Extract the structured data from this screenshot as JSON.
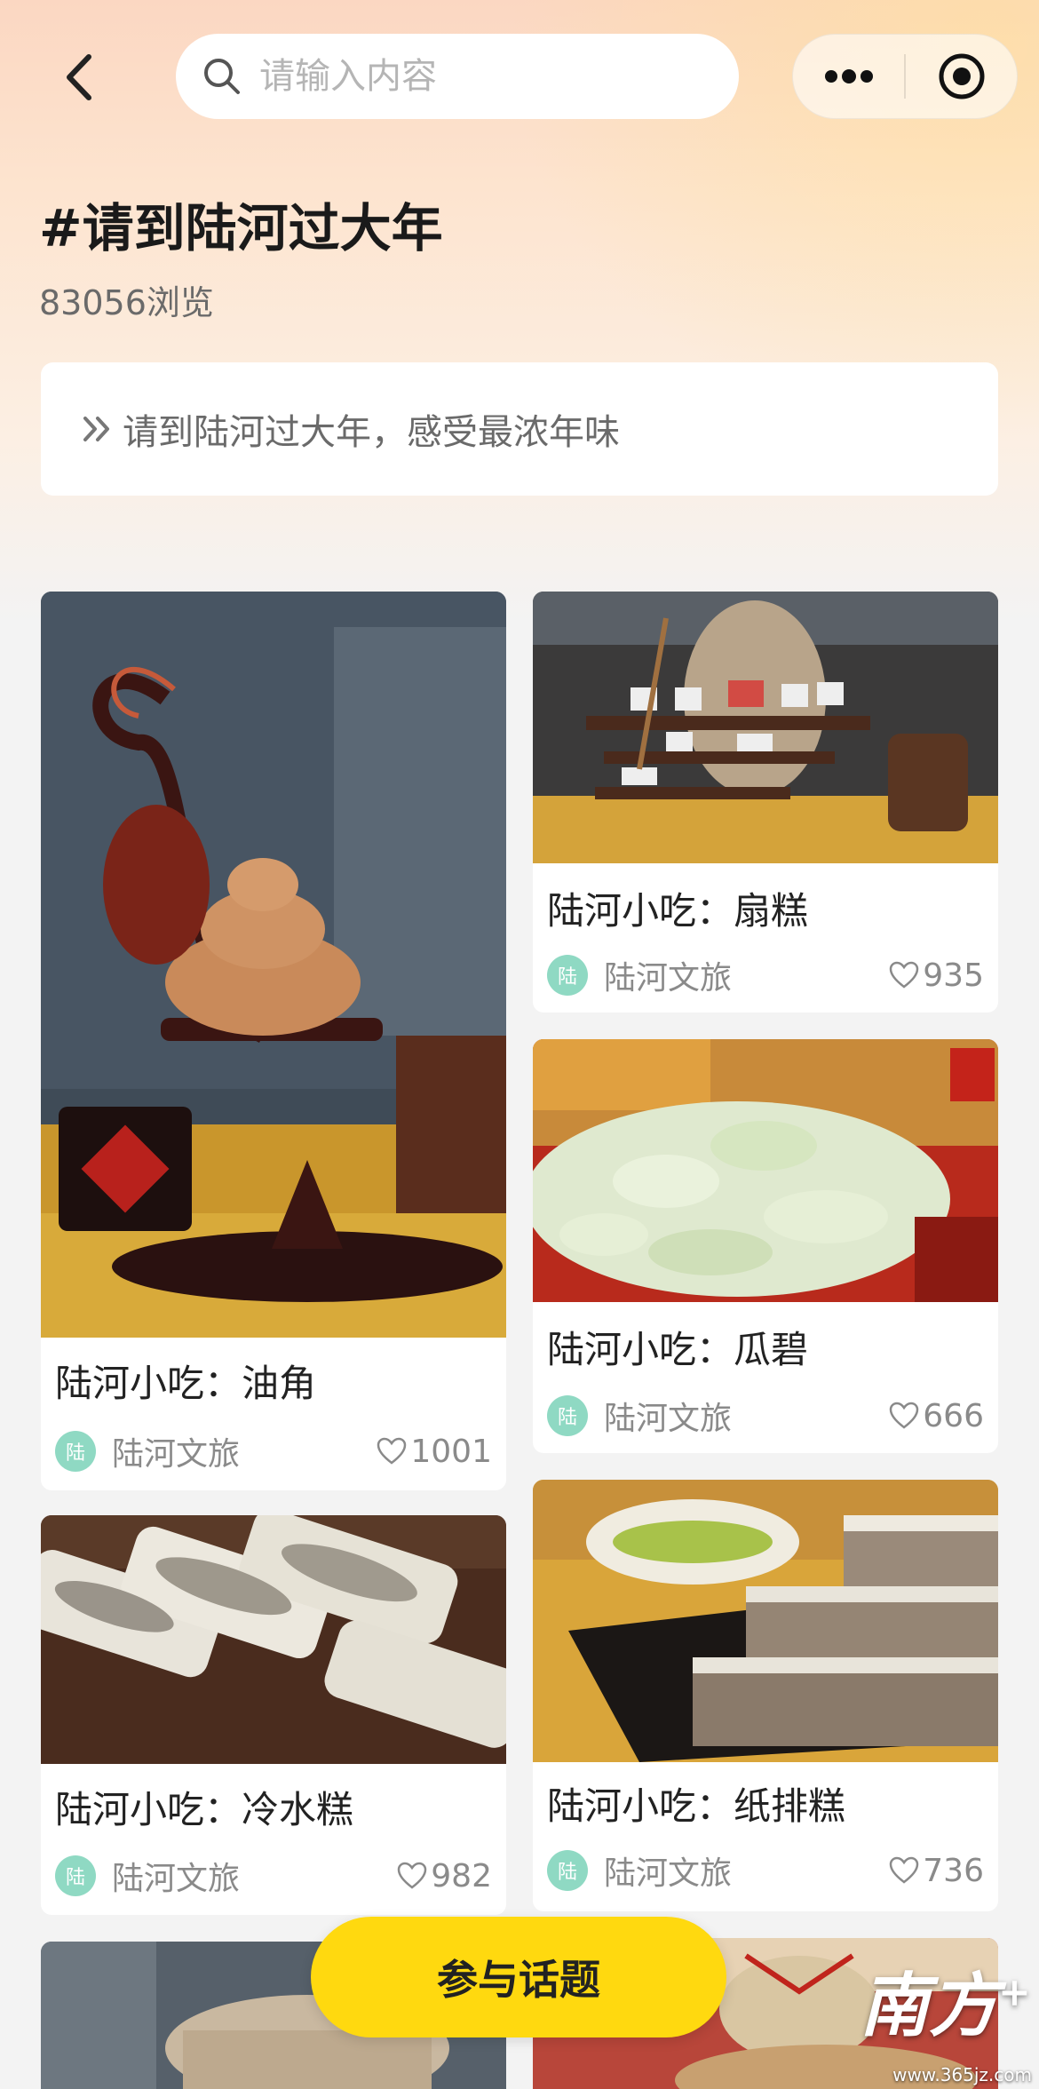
{
  "search": {
    "placeholder": "请输入内容"
  },
  "topic": {
    "title": "#请到陆河过大年",
    "views": "83056浏览",
    "summary": "请到陆河过大年，感受最浓年味"
  },
  "posts": [
    {
      "title": "陆河小吃：油角",
      "avatar": "陆",
      "author": "陆河文旅",
      "likes": "1001"
    },
    {
      "title": "陆河小吃：扇糕",
      "avatar": "陆",
      "author": "陆河文旅",
      "likes": "935"
    },
    {
      "title": "陆河小吃：瓜碧",
      "avatar": "陆",
      "author": "陆河文旅",
      "likes": "666"
    },
    {
      "title": "陆河小吃：冷水糕",
      "avatar": "陆",
      "author": "陆河文旅",
      "likes": "982"
    },
    {
      "title": "陆河小吃：纸排糕",
      "avatar": "陆",
      "author": "陆河文旅",
      "likes": "736"
    }
  ],
  "join_button": "参与话题",
  "logo": {
    "text": "南方",
    "sup": "+"
  },
  "watermark": "www.365jz.com",
  "colors": {
    "accent": "#ffd90f",
    "avatar": "#8fd9c3"
  }
}
